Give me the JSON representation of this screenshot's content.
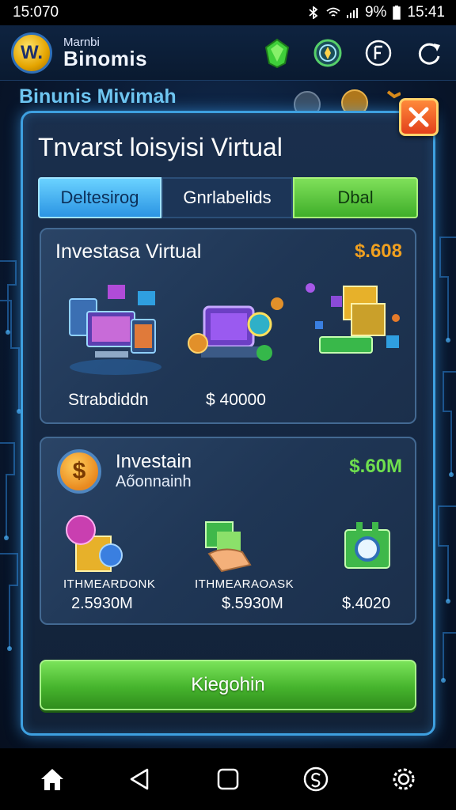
{
  "status_bar": {
    "time_left": "15:070",
    "signal_text": "9%",
    "time_right": "15:41"
  },
  "header": {
    "logo_letter": "W.",
    "brand_small": "Marnbi",
    "brand_main": "Binomis",
    "icons": [
      "gem-icon",
      "compass-icon",
      "currency-icon",
      "refresh-icon"
    ]
  },
  "subheading": "Binunis Mivimah",
  "modal": {
    "title": "Tnvarst loisyisi Virtual",
    "tabs": [
      {
        "label": "Deltesirog"
      },
      {
        "label": "Gnrlabelids"
      },
      {
        "label": "Dbal"
      }
    ]
  },
  "card1": {
    "title": "Investasa Virtual",
    "value": "$.608",
    "items": [
      {
        "label": "Strabdiddn"
      },
      {
        "label": "$ 40000"
      }
    ]
  },
  "card2": {
    "title": "Investain",
    "subtitle": "Aőonnainh",
    "value": "$.60M",
    "coin_symbol": "$",
    "items": [
      {
        "name": "ITHMEARDONK",
        "value": "2.5930M"
      },
      {
        "name": "ITHMEARAOASK",
        "value": "$.5930M"
      },
      {
        "name": "",
        "value": "$.4020"
      }
    ]
  },
  "cta_label": "Kiegohin",
  "colors": {
    "accent_blue": "#3ea0e0",
    "accent_green": "#46b42d",
    "accent_orange": "#f0a020",
    "value_green": "#6fe04e"
  },
  "nav": [
    "home-icon",
    "back-icon",
    "square-icon",
    "coin-circle-icon",
    "settings-icon"
  ]
}
